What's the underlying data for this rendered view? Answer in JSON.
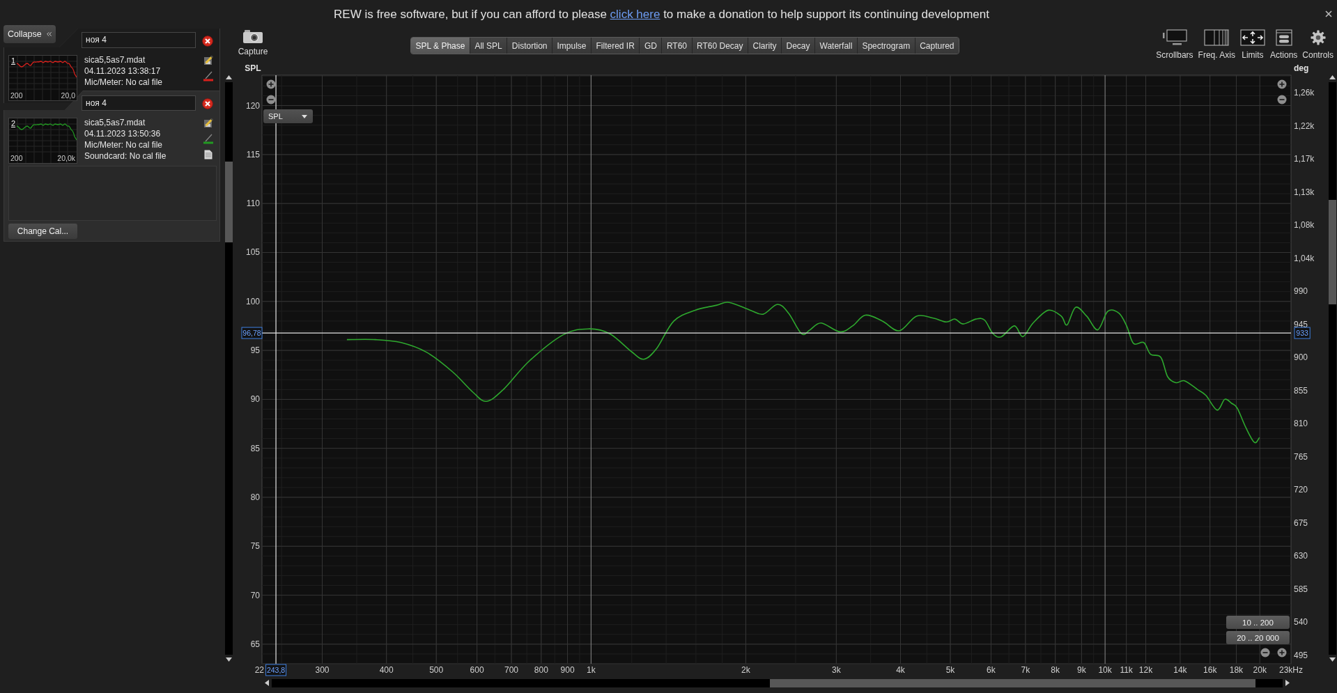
{
  "banner": {
    "before": "REW is free software, but if you can afford to please",
    "link": "click here",
    "after": "to make a donation to help support its continuing development"
  },
  "collapse_button": {
    "label": "Collapse"
  },
  "measurements": [
    {
      "number": "1",
      "name": "ноя 4",
      "selected": false,
      "color": "#d9201c",
      "thumb_labels": [
        "200",
        "20,0"
      ],
      "lines": [
        "sica5,5as7.mdat",
        "04.11.2023 13:38:17",
        "Mic/Meter: No cal file"
      ]
    },
    {
      "number": "2",
      "name": "ноя 4",
      "selected": true,
      "color": "#229a22",
      "thumb_labels": [
        "200",
        "20,0k"
      ],
      "lines": [
        "sica5,5as7.mdat",
        "04.11.2023 13:50:36",
        "Mic/Meter: No cal file",
        "Soundcard: No cal file"
      ]
    }
  ],
  "change_cal_button": {
    "label": "Change Cal..."
  },
  "capture_button": {
    "label": "Capture"
  },
  "tabs": [
    {
      "label": "SPL & Phase",
      "selected": true
    },
    {
      "label": "All SPL",
      "selected": false
    },
    {
      "label": "Distortion",
      "selected": false
    },
    {
      "label": "Impulse",
      "selected": false
    },
    {
      "label": "Filtered IR",
      "selected": false
    },
    {
      "label": "GD",
      "selected": false
    },
    {
      "label": "RT60",
      "selected": false
    },
    {
      "label": "RT60 Decay",
      "selected": false
    },
    {
      "label": "Clarity",
      "selected": false
    },
    {
      "label": "Decay",
      "selected": false
    },
    {
      "label": "Waterfall",
      "selected": false
    },
    {
      "label": "Spectrogram",
      "selected": false
    },
    {
      "label": "Captured",
      "selected": false
    }
  ],
  "toolbar": [
    {
      "kind": "scrollbars",
      "label": "Scrollbars"
    },
    {
      "kind": "freq_axis",
      "label": "Freq. Axis"
    },
    {
      "kind": "limits",
      "label": "Limits"
    },
    {
      "kind": "actions",
      "label": "Actions"
    },
    {
      "kind": "controls",
      "label": "Controls"
    }
  ],
  "chart": {
    "trace_selector": "SPL",
    "range_buttons": [
      "10 .. 200",
      "20 .. 20 000"
    ],
    "axis_end_labels": [
      "22",
      "23kHz"
    ],
    "phase_axis": {
      "label": "deg",
      "readout": "933",
      "ticks": [
        "1,26k",
        "1,22k",
        "1,17k",
        "1,13k",
        "1,08k",
        "1,04k",
        "990",
        "945",
        "900",
        "855",
        "810",
        "765",
        "720",
        "675",
        "630",
        "585",
        "540",
        "495"
      ]
    },
    "chart_data": {
      "type": "line",
      "ylabel": "SPL",
      "log": "x",
      "grid": true,
      "x": [
        335,
        381,
        427,
        479,
        538,
        590,
        626,
        675,
        758,
        883,
        989,
        1088,
        1197,
        1267,
        1342,
        1449,
        1594,
        1752,
        1856,
        2041,
        2162,
        2306,
        2423,
        2568,
        2667,
        2803,
        3048,
        3228,
        3418,
        3687,
        3977,
        4296,
        4633,
        4909,
        5103,
        5297,
        5610,
        5828,
        6055,
        6285,
        6663,
        6918,
        7244,
        7757,
        8217,
        8435,
        8763,
        9209,
        9678,
        10125,
        10641,
        11013,
        11362,
        11890,
        12261,
        12835,
        13240,
        13740,
        14270,
        15136,
        15712,
        16516,
        17088,
        17617,
        18078,
        18793,
        19520,
        19970
      ],
      "series": [
        {
          "color": "#2ea82e",
          "values": [
            96.1,
            96.1,
            95.8,
            94.8,
            92.8,
            90.7,
            89.8,
            91.0,
            93.9,
            96.6,
            97.2,
            96.7,
            94.9,
            94.1,
            95.2,
            98.0,
            99.1,
            99.6,
            99.9,
            99.1,
            98.7,
            99.7,
            98.8,
            96.7,
            97.1,
            97.8,
            96.9,
            97.5,
            98.6,
            98.0,
            97.0,
            98.5,
            98.3,
            97.9,
            98.2,
            97.7,
            98.2,
            98.1,
            96.7,
            96.4,
            97.5,
            96.4,
            97.8,
            99.1,
            98.5,
            97.6,
            99.4,
            98.5,
            97.1,
            99.0,
            98.8,
            97.5,
            95.7,
            95.8,
            94.6,
            94.3,
            92.3,
            91.7,
            91.9,
            91.0,
            90.4,
            88.9,
            90.0,
            89.6,
            89.1,
            87.1,
            85.6,
            86.1
          ]
        }
      ],
      "xlim": [
        229,
        23000
      ],
      "ylim": [
        63,
        123.1
      ],
      "xticks": [
        {
          "value": 300,
          "label": "300"
        },
        {
          "value": 400,
          "label": "400"
        },
        {
          "value": 500,
          "label": "500"
        },
        {
          "value": 600,
          "label": "600"
        },
        {
          "value": 700,
          "label": "700"
        },
        {
          "value": 800,
          "label": "800"
        },
        {
          "value": 900,
          "label": "900"
        },
        {
          "value": 1000,
          "label": "1k"
        },
        {
          "value": 2000,
          "label": "2k"
        },
        {
          "value": 3000,
          "label": "3k"
        },
        {
          "value": 4000,
          "label": "4k"
        },
        {
          "value": 5000,
          "label": "5k"
        },
        {
          "value": 6000,
          "label": "6k"
        },
        {
          "value": 7000,
          "label": "7k"
        },
        {
          "value": 8000,
          "label": "8k"
        },
        {
          "value": 9000,
          "label": "9k"
        },
        {
          "value": 10000,
          "label": "10k"
        },
        {
          "value": 11000,
          "label": "11k"
        },
        {
          "value": 12000,
          "label": "12k"
        },
        {
          "value": 14000,
          "label": "14k"
        },
        {
          "value": 16000,
          "label": "16k"
        },
        {
          "value": 18000,
          "label": "18k"
        },
        {
          "value": 20000,
          "label": "20k"
        }
      ],
      "yticks": [
        65,
        70,
        75,
        80,
        85,
        90,
        95,
        100,
        105,
        110,
        115,
        120
      ],
      "ref_lines": [
        {
          "axis": "x",
          "value": 243.8,
          "label": "243,8"
        },
        {
          "axis": "y",
          "value": 96.78,
          "label": "96,78"
        }
      ]
    }
  }
}
